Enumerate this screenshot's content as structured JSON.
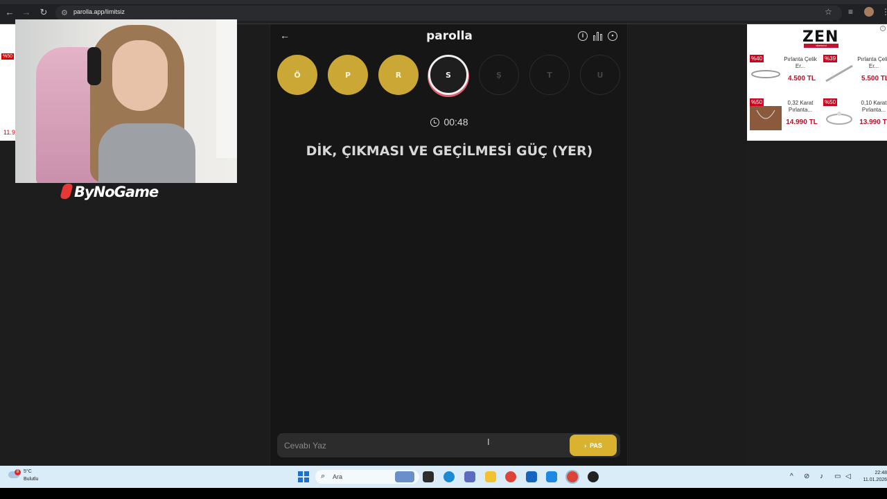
{
  "browser": {
    "url": "parolla.app/limitsiz"
  },
  "game": {
    "title": "parolla",
    "letters": [
      {
        "char": "Ö",
        "state": "done"
      },
      {
        "char": "P",
        "state": "done"
      },
      {
        "char": "R",
        "state": "done"
      },
      {
        "char": "S",
        "state": "current"
      },
      {
        "char": "Ş",
        "state": "pending"
      },
      {
        "char": "T",
        "state": "pending"
      },
      {
        "char": "U",
        "state": "pending"
      }
    ],
    "timer": "00:48",
    "question": "DİK, ÇIKMASI VE GEÇİLMESİ GÜÇ (YER)",
    "answer_placeholder": "Cevabı Yaz",
    "pass_label": "PAS"
  },
  "stream": {
    "logo_text": "ByNoGame"
  },
  "left_ad": {
    "badge": "%50",
    "price": "11.9"
  },
  "ad": {
    "brand": "ZEN",
    "brand_sub": "diamond",
    "products": [
      {
        "badge": "%40",
        "name": "Pırlanta Çelik Er...",
        "price": "4.500 TL"
      },
      {
        "badge": "%39",
        "name": "Pırlanta Çelik Er...",
        "price": "5.500 TL"
      },
      {
        "badge": "%50",
        "name": "0,32 Karat Pırlanta...",
        "price": "14.990 TL"
      },
      {
        "badge": "%50",
        "name": "0,10 Karat Pırlanta...",
        "price": "13.990 TL"
      }
    ]
  },
  "taskbar": {
    "weather_temp": "5°C",
    "weather_cond": "Bulutlu",
    "weather_badge": "8",
    "search_label": "Ara",
    "time": "22:48",
    "date": "11.01.2026"
  },
  "colors": {
    "accent_gold": "#cba836",
    "pass_button": "#d9b32f",
    "current_ring": "#e15e6c"
  }
}
